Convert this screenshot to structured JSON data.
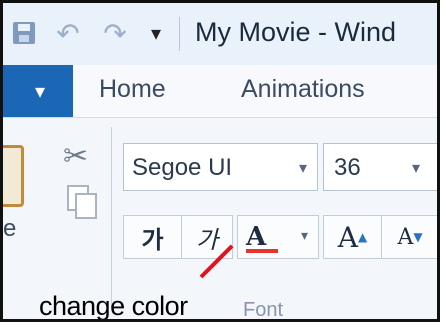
{
  "titlebar": {
    "title": "My Movie - Wind",
    "icons": [
      "save-icon",
      "undo-icon",
      "redo-icon",
      "qat-menu-icon"
    ]
  },
  "tabs": [
    {
      "label": "Home"
    },
    {
      "label": "Animations"
    }
  ],
  "clipboard": {
    "paste_label_fragment": "e"
  },
  "font": {
    "font_family": "Segoe UI",
    "font_size": "36",
    "bold_label": "가",
    "italic_label": "가",
    "color_label": "A",
    "grow_label": "A",
    "shrink_label": "A",
    "group_label": "Font",
    "font_color": "#e7332c"
  },
  "annotation": {
    "text": "change color",
    "pointer_color": "#e0141b"
  },
  "colors": {
    "file_tab": "#1c67b5",
    "ribbon_bg": "#f3f6fa"
  }
}
